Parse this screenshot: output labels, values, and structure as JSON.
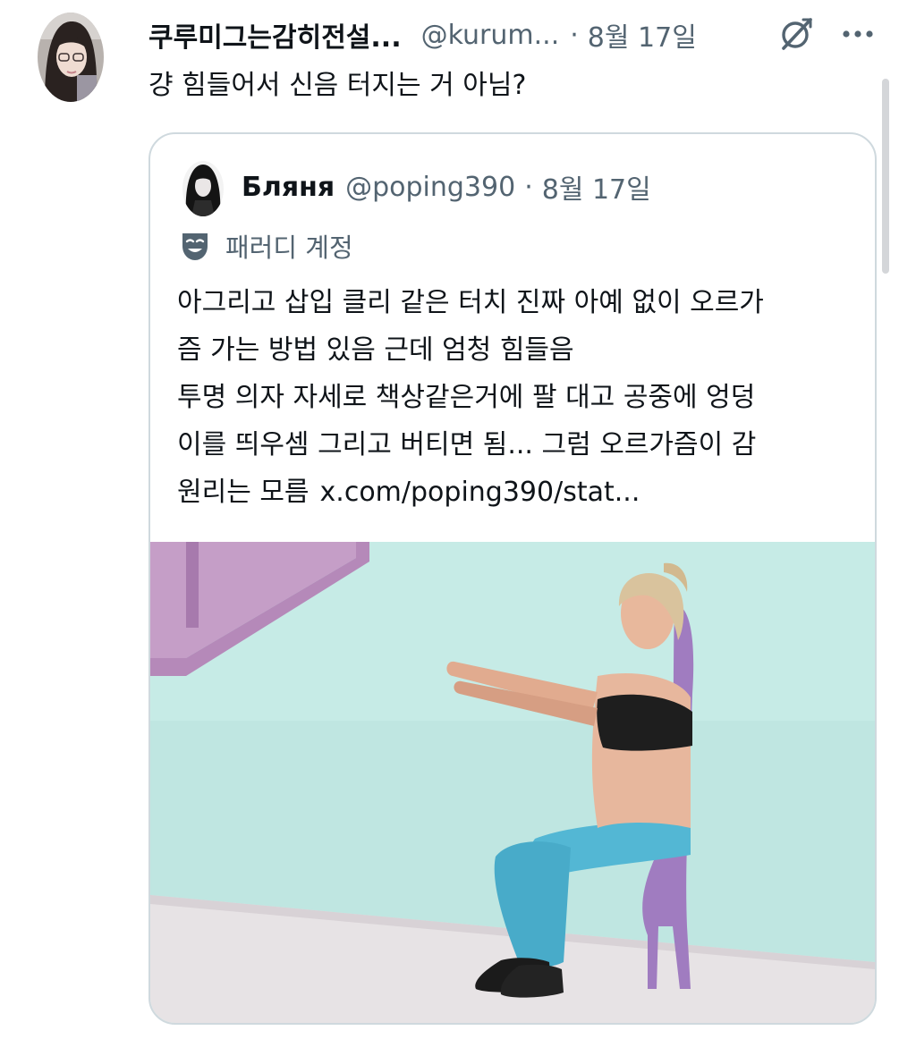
{
  "tweet": {
    "author": {
      "display_name": "쿠루미그는감히전설...",
      "handle": "@kurum...",
      "avatar_icon": "profile-avatar"
    },
    "separator": "·",
    "date": "8월 17일",
    "grok_icon": "grok-slash-icon",
    "more_icon": "more-dots-icon",
    "text": "걍 힘들어서 신음 터지는 거 아님?"
  },
  "quoted_tweet": {
    "author": {
      "display_name": "Бляня",
      "handle": "@poping390",
      "avatar_icon": "profile-avatar"
    },
    "separator": "·",
    "date": "8월 17일",
    "parody": {
      "icon": "theater-mask-icon",
      "label": "패러디 계정"
    },
    "text_lines": [
      "아그리고 삽입 클리 같은 터치 진짜 아예 없이 오르가",
      "즘 가는 방법 있음 근데 엄청 힘들음",
      "투명 의자 자세로 책상같은거에 팔 대고 공중에 엉덩",
      "이를 띄우셈 그리고 버티면 됨... 그럼 오르가즘이 감",
      "원리는 모름"
    ],
    "link": "x.com/poping390/stat...",
    "media": {
      "type": "photo",
      "subject": "woman doing wall-sit exercise"
    }
  },
  "colors": {
    "text_primary": "#0f1419",
    "text_secondary": "#536471",
    "border": "#cfd9de",
    "background": "#ffffff"
  }
}
